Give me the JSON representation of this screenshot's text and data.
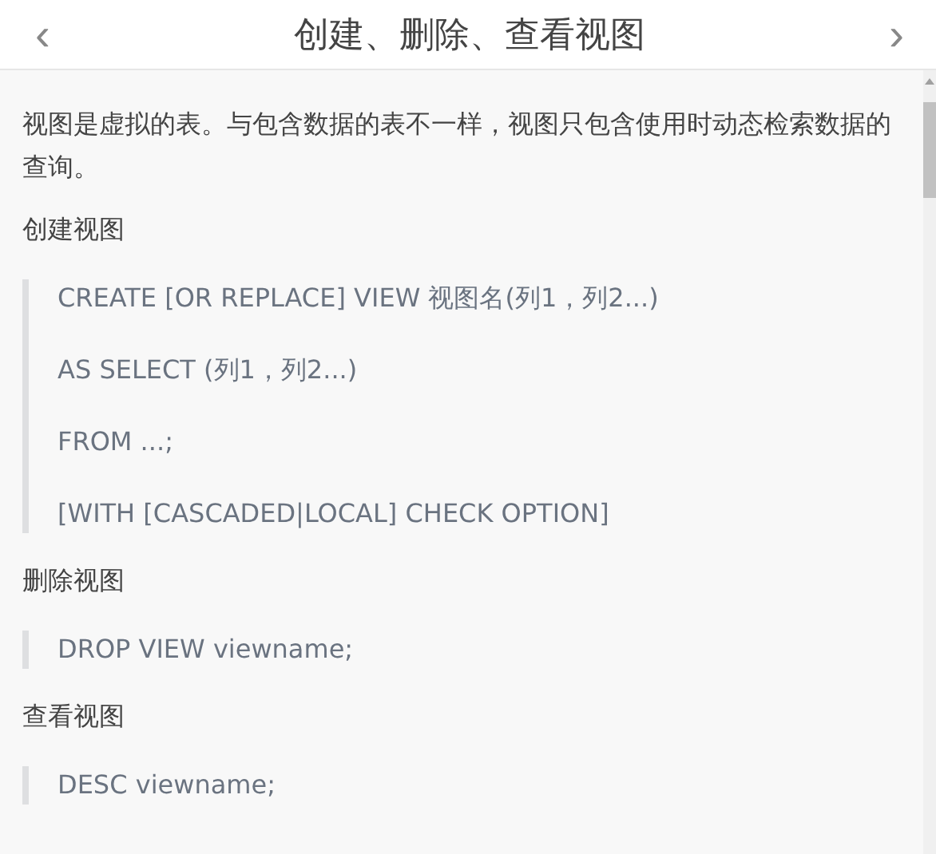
{
  "header": {
    "back": "‹",
    "title": "创建、删除、查看视图",
    "forward": "›"
  },
  "blocks": [
    {
      "kind": "paragraph",
      "text": "视图是虚拟的表。与包含数据的表不一样，视图只包含使用时动态检索数据的查询。"
    },
    {
      "kind": "paragraph",
      "text": "创建视图"
    },
    {
      "kind": "quote",
      "lines": [
        "CREATE [OR REPLACE] VIEW 视图名(列1，列2...)",
        "AS SELECT (列1，列2...)",
        "FROM ...;",
        "[WITH [CASCADED|LOCAL] CHECK OPTION]"
      ]
    },
    {
      "kind": "paragraph",
      "text": "删除视图"
    },
    {
      "kind": "quote",
      "lines": [
        "DROP VIEW viewname;"
      ]
    },
    {
      "kind": "paragraph",
      "text": "查看视图"
    },
    {
      "kind": "quote",
      "lines": [
        "DESC viewname;"
      ]
    }
  ]
}
